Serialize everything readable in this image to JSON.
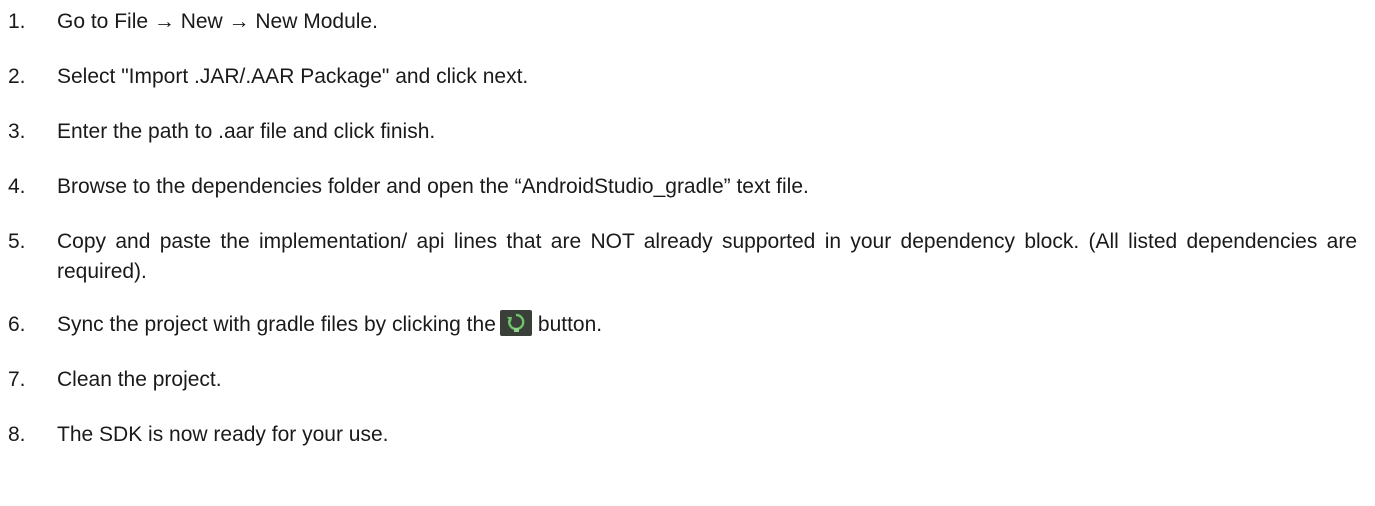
{
  "steps": [
    {
      "num": "1.",
      "text": "Go to File → New → New Module."
    },
    {
      "num": "2.",
      "text": "Select \"Import .JAR/.AAR Package\" and click next."
    },
    {
      "num": "3.",
      "text": "Enter the path to .aar file and click finish."
    },
    {
      "num": "4.",
      "text": "Browse to the dependencies folder and open the “AndroidStudio_gradle” text file."
    },
    {
      "num": "5.",
      "text": "Copy and paste the implementation/ api lines that are NOT already supported in your dependency block. (All listed dependencies are required)."
    },
    {
      "num": "6.",
      "text_before": "Sync the project with gradle files by clicking the",
      "text_after": "button."
    },
    {
      "num": "7.",
      "text": "Clean the project."
    },
    {
      "num": "8.",
      "text": "The SDK is now ready for your use."
    }
  ],
  "icons": {
    "sync": "gradle-sync-icon"
  },
  "colors": {
    "text": "#1a1a1a",
    "sync_icon_bg": "#3a3f3a",
    "sync_icon_arrow": "#6fc46a"
  }
}
